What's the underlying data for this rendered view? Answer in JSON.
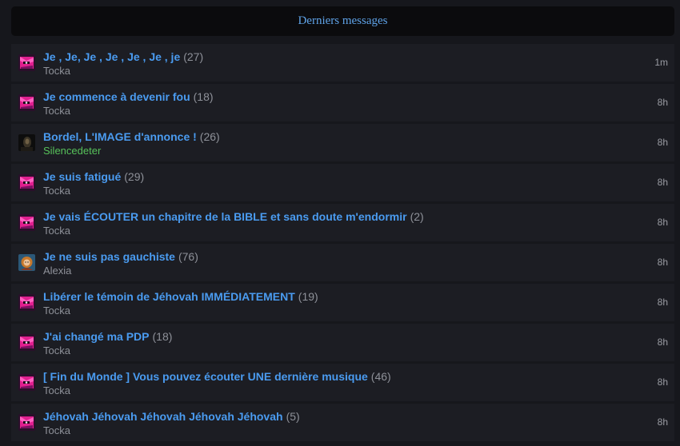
{
  "header": {
    "title": "Derniers messages"
  },
  "colors": {
    "accent": "#4a9bf0",
    "count": "#8e9199",
    "author_default": "#8e9199",
    "author_green": "#57c25a"
  },
  "threads": [
    {
      "title": "Je , Je, Je , Je , Je , Je , je",
      "count": "(27)",
      "author": "Tocka",
      "author_color": "default",
      "avatar": "tocka",
      "time": "1m"
    },
    {
      "title": "Je commence à devenir fou",
      "count": "(18)",
      "author": "Tocka",
      "author_color": "default",
      "avatar": "tocka",
      "time": "8h"
    },
    {
      "title": "Bordel, L'IMAGE d'annonce !",
      "count": "(26)",
      "author": "Silencedeter",
      "author_color": "green",
      "avatar": "silencedeter",
      "time": "8h"
    },
    {
      "title": "Je suis fatigué",
      "count": "(29)",
      "author": "Tocka",
      "author_color": "default",
      "avatar": "tocka",
      "time": "8h"
    },
    {
      "title": "Je vais ÉCOUTER un chapitre de la BIBLE et sans doute m'endormir",
      "count": "(2)",
      "author": "Tocka",
      "author_color": "default",
      "avatar": "tocka",
      "time": "8h"
    },
    {
      "title": "Je ne suis pas gauchiste",
      "count": "(76)",
      "author": "Alexia",
      "author_color": "default",
      "avatar": "alexia",
      "time": "8h"
    },
    {
      "title": "Libérer le témoin de Jéhovah IMMÉDIATEMENT",
      "count": "(19)",
      "author": "Tocka",
      "author_color": "default",
      "avatar": "tocka",
      "time": "8h"
    },
    {
      "title": "J'ai changé ma PDP",
      "count": "(18)",
      "author": "Tocka",
      "author_color": "default",
      "avatar": "tocka",
      "time": "8h"
    },
    {
      "title": "[ Fin du Monde ] Vous pouvez écouter UNE dernière musique",
      "count": "(46)",
      "author": "Tocka",
      "author_color": "default",
      "avatar": "tocka",
      "time": "8h"
    },
    {
      "title": "Jéhovah Jéhovah Jéhovah Jéhovah Jéhovah",
      "count": "(5)",
      "author": "Tocka",
      "author_color": "default",
      "avatar": "tocka",
      "time": "8h"
    }
  ]
}
